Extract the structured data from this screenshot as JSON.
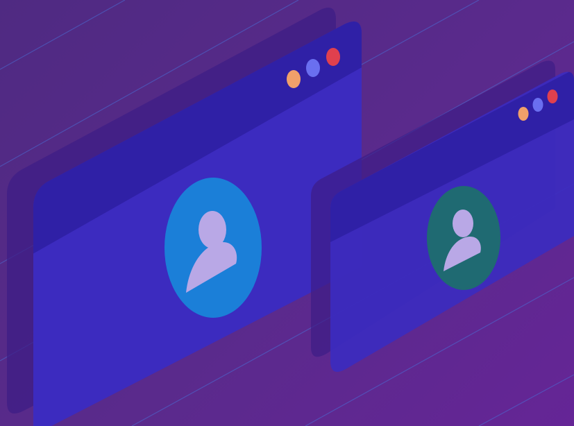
{
  "illustration": {
    "background_color": "#5a2a8c",
    "accent_line_color": "#4a6fd6",
    "windows": [
      {
        "id": "large-window",
        "frame_color": "#3c2bbf",
        "titlebar_color": "#2f20a6",
        "shadow_color": "#3d1d86",
        "avatar_circle_color": "#1b7fd8",
        "avatar_figure_color": "#b9a8e6",
        "icon": "user-avatar-icon",
        "dots": [
          {
            "name": "orange-dot",
            "color": "#f0a06a"
          },
          {
            "name": "blue-dot",
            "color": "#6a6ff0"
          },
          {
            "name": "red-dot",
            "color": "#e0404e"
          }
        ]
      },
      {
        "id": "small-window",
        "frame_color": "#3c2bbf",
        "titlebar_color": "#2f20a6",
        "shadow_color": "#3d1d86",
        "avatar_circle_color": "#1f6a72",
        "avatar_figure_color": "#b9a8e6",
        "icon": "user-avatar-icon",
        "dots": [
          {
            "name": "orange-dot",
            "color": "#f0a06a"
          },
          {
            "name": "blue-dot",
            "color": "#6a6ff0"
          },
          {
            "name": "red-dot",
            "color": "#e0404e"
          }
        ]
      }
    ]
  }
}
